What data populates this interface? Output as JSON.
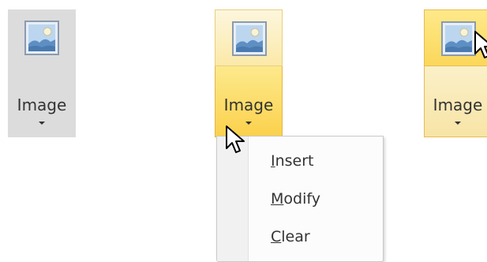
{
  "buttons": [
    {
      "label": "Image",
      "state": "pressed",
      "icon": "image-icon"
    },
    {
      "label": "Image",
      "state": "hover-dropdown",
      "icon": "image-icon"
    },
    {
      "label": "Image",
      "state": "hover-top",
      "icon": "image-icon"
    }
  ],
  "menu": {
    "items": [
      {
        "label": "Insert",
        "mnemonic": "I",
        "rest": "nsert"
      },
      {
        "label": "Modify",
        "mnemonic": "M",
        "rest": "odify"
      },
      {
        "label": "Clear",
        "mnemonic": "C",
        "rest": "lear"
      }
    ]
  },
  "colors": {
    "hover_gold": "#fbd14c",
    "hover_light": "#fdf6dd",
    "pressed_grey": "#dcdcdc",
    "text": "#333333"
  }
}
